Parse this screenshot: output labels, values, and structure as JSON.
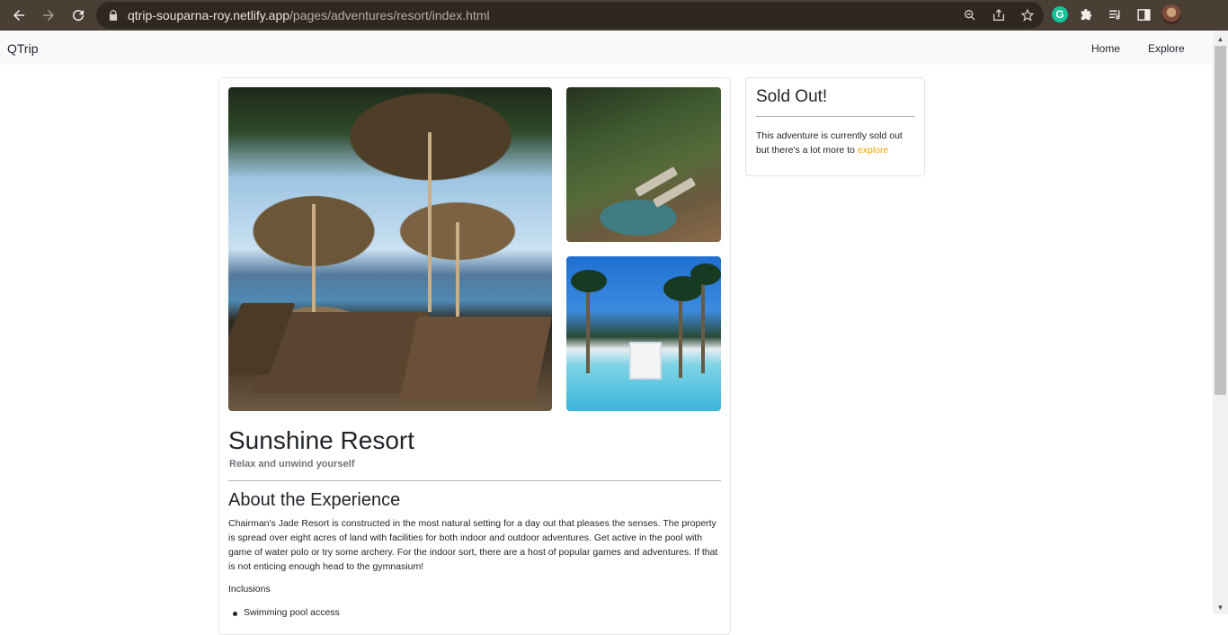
{
  "browser": {
    "url_host": "qtrip-souparna-roy.netlify.app",
    "url_path": "/pages/adventures/resort/index.html",
    "icons": [
      "back-icon",
      "forward-icon",
      "reload-icon",
      "lock-icon",
      "zoom-icon",
      "share-icon",
      "bookmark-star-icon",
      "grammarly-icon",
      "extensions-icon",
      "media-icon",
      "side-panel-icon",
      "profile-avatar"
    ],
    "grammarly_glyph": "G"
  },
  "nav": {
    "brand": "QTrip",
    "home": "Home",
    "explore": "Explore"
  },
  "adventure": {
    "name": "Sunshine Resort",
    "subtitle": "Relax and unwind yourself",
    "about_heading": "About the Experience",
    "description": "Chairman's Jade Resort is constructed in the most natural setting for a day out that pleases the senses. The property is spread over eight acres of land with facilities for both indoor and outdoor adventures. Get active in the pool with game of water polo or try some archery. For the indoor sort, there are a host of popular games and adventures. If that is not enticing enough head to the gymnasium!",
    "inclusions_heading": "Inclusions",
    "inclusions": [
      "Swimming pool access"
    ]
  },
  "reservation": {
    "title": "Sold Out!",
    "text": "This adventure is currently sold out but there's a lot more to",
    "link": "explore"
  },
  "colors": {
    "browser_frame": "#4a3f35",
    "navbar_bg": "#f8f9fa",
    "link_accent": "#f5a300"
  }
}
